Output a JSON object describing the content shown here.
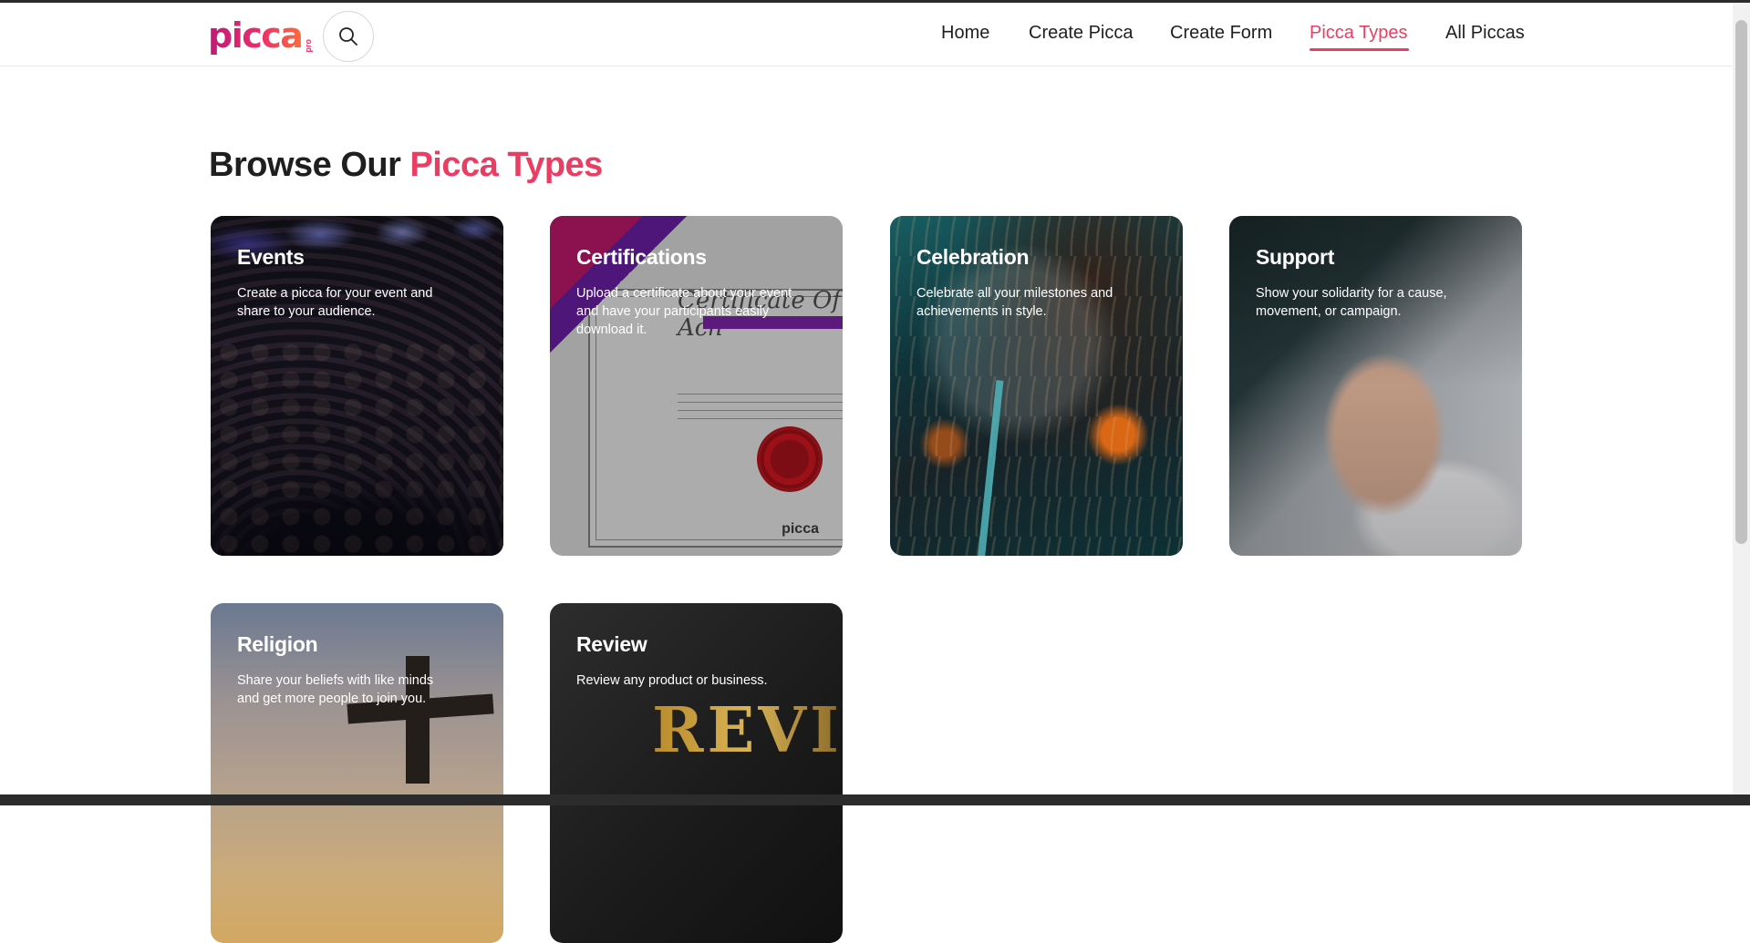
{
  "brand": {
    "logo_text": "picca",
    "logo_suffix": "pro"
  },
  "header": {
    "search_icon": "search-icon",
    "nav": [
      {
        "label": "Home",
        "active": false
      },
      {
        "label": "Create Picca",
        "active": false
      },
      {
        "label": "Create Form",
        "active": false
      },
      {
        "label": "Picca Types",
        "active": true
      },
      {
        "label": "All Piccas",
        "active": false
      }
    ],
    "accent_color": "#ea3d63"
  },
  "main": {
    "title_prefix": "Browse Our ",
    "title_accent": "Picca Types",
    "cards": [
      {
        "title": "Events",
        "description": "Create a picca for your event and share to your audience."
      },
      {
        "title": "Certifications",
        "description": "Upload a certificate about your event and have your participants easily download it."
      },
      {
        "title": "Celebration",
        "description": "Celebrate all your milestones and achievements in style."
      },
      {
        "title": "Support",
        "description": "Show your solidarity for a cause, movement, or campaign."
      },
      {
        "title": "Religion",
        "description": "Share your beliefs with like minds and get more people to join you."
      },
      {
        "title": "Review",
        "description": "Review any product or business."
      }
    ],
    "certificate_image": {
      "script": "Certificate Of Ach",
      "mark": "picca"
    },
    "review_image": {
      "word": "REVI"
    }
  }
}
